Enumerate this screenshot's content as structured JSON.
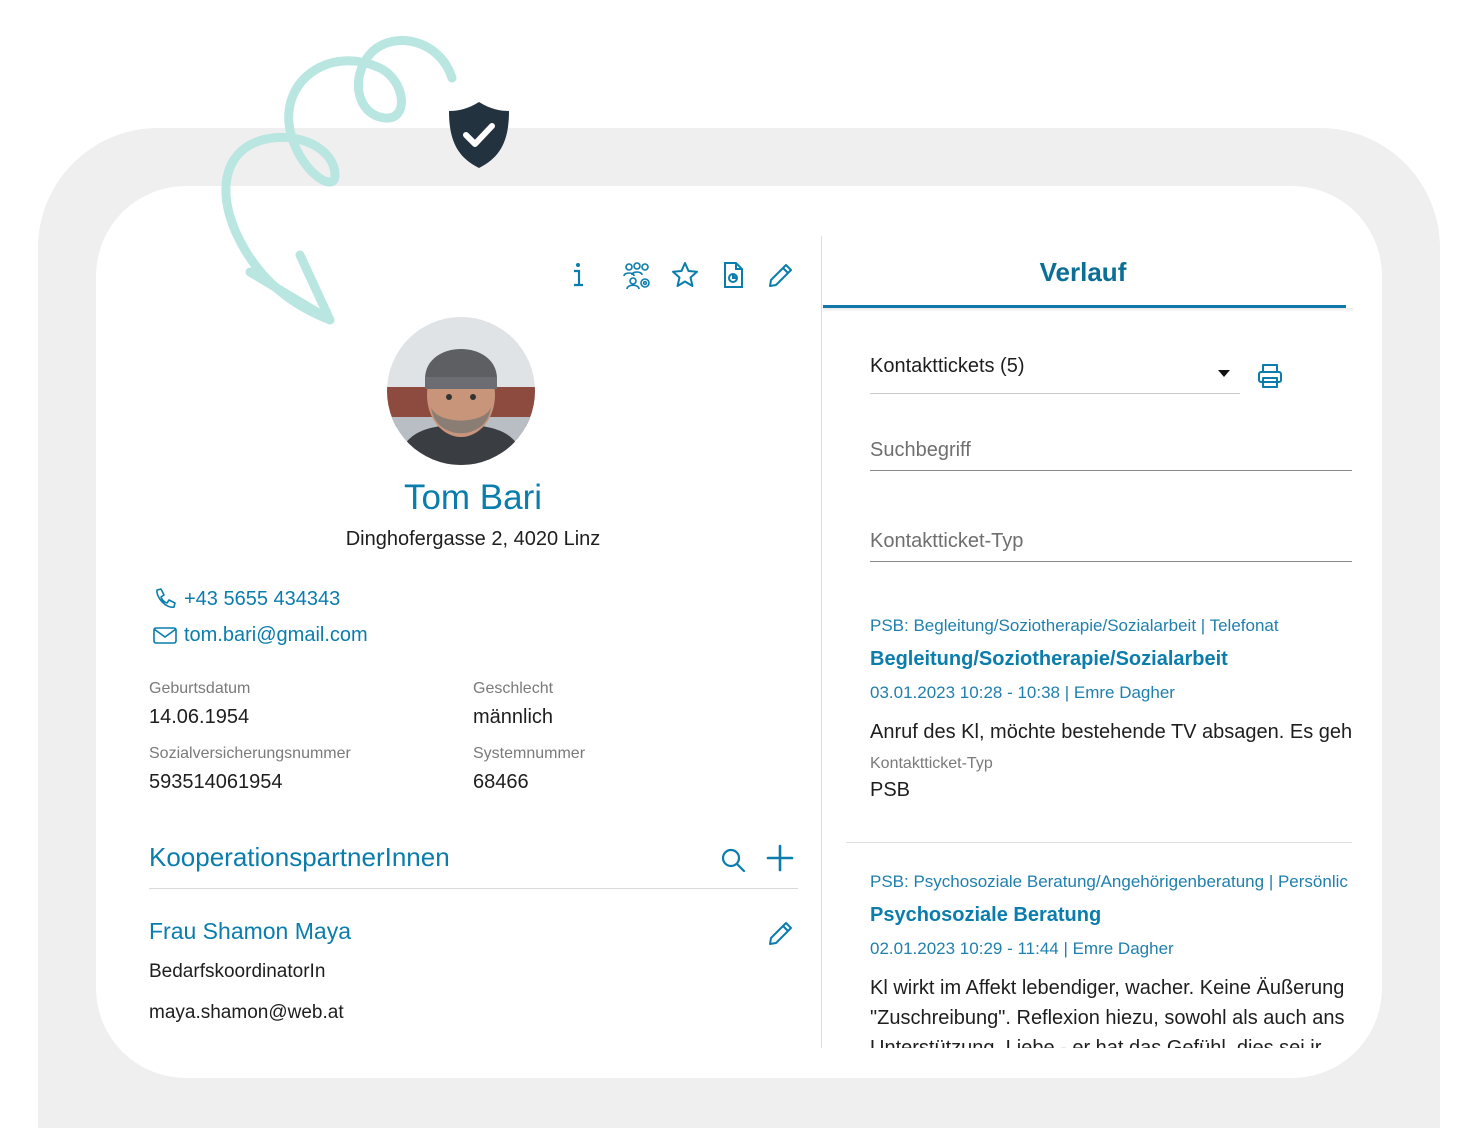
{
  "colors": {
    "accent": "#0b7dad",
    "background": "#efefef",
    "shield": "#23323f",
    "swirl": "#b9e6e1"
  },
  "icons": {
    "deco": [
      "swirl-arrow",
      "shield-check-icon"
    ],
    "toolbar": [
      "info-icon",
      "group-settings-icon",
      "star-icon",
      "document-icon",
      "pencil-icon"
    ]
  },
  "profile": {
    "name": "Tom Bari",
    "address": "Dinghofergasse 2, 4020 Linz",
    "phone": "+43 5655 434343",
    "email": "tom.bari@gmail.com",
    "fields": {
      "birth_label": "Geburtsdatum",
      "birth_value": "14.06.1954",
      "gender_label": "Geschlecht",
      "gender_value": "männlich",
      "ssn_label": "Sozialversicherungsnummer",
      "ssn_value": "593514061954",
      "sysnum_label": "Systemnummer",
      "sysnum_value": "68466"
    }
  },
  "partners": {
    "title": "KooperationspartnerInnen",
    "items": [
      {
        "name": "Frau Shamon Maya",
        "role": "BedarfskoordinatorIn",
        "email": "maya.shamon@web.at"
      }
    ]
  },
  "history": {
    "tab": "Verlauf",
    "filter_selected": "Kontakttickets (5)",
    "search_placeholder": "Suchbegriff",
    "type_placeholder": "Kontaktticket-Typ",
    "entries": [
      {
        "meta": "PSB: Begleitung/Soziotherapie/Sozialarbeit | Telefonat",
        "title": "Begleitung/Soziotherapie/Sozialarbeit",
        "date": "03.01.2023 10:28 - 10:38 | Emre Dagher",
        "text1": "Anruf des Kl, möchte bestehende TV absagen. Es geh",
        "type_label": "Kontaktticket-Typ",
        "type_value": "PSB"
      },
      {
        "meta": "PSB: Psychosoziale Beratung/Angehörigenberatung | Persönlic",
        "title": "Psychosoziale Beratung",
        "date": "02.01.2023 10:29 - 11:44 | Emre Dagher",
        "text1": "Kl wirkt im Affekt lebendiger, wacher. Keine Äußerung",
        "text2": "\"Zuschreibung\". Reflexion hiezu, sowohl als auch ans",
        "text3": "Unterstützung, Liebe - er hat das Gefühl, dies sei ir"
      }
    ]
  }
}
